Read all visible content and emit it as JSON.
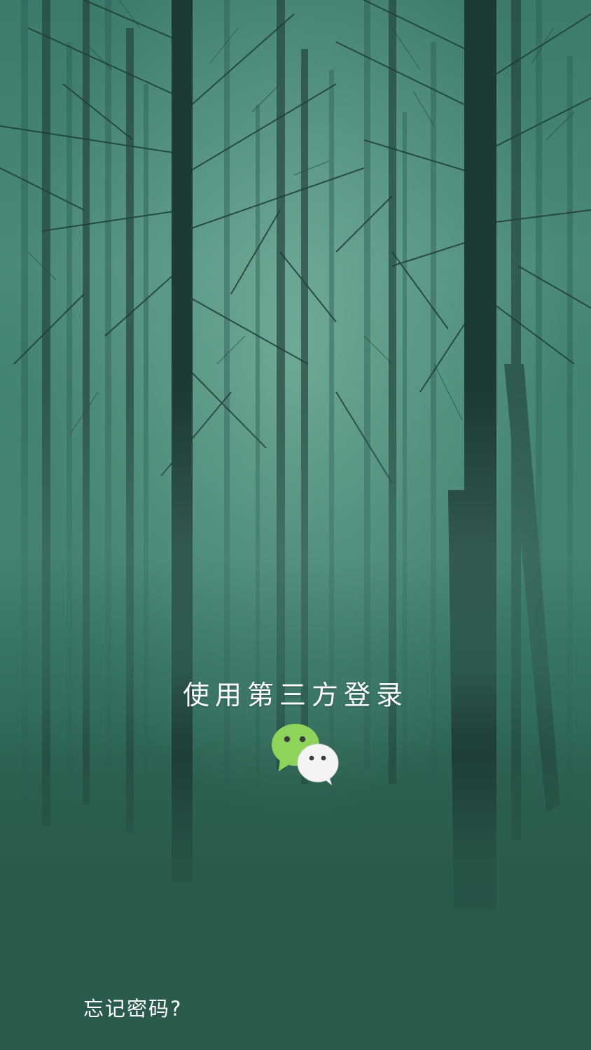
{
  "login": {
    "third_party_title": "使用第三方登录",
    "forgot_password": "忘记密码?"
  },
  "icons": {
    "wechat": "wechat-icon"
  },
  "colors": {
    "background_top": "#3c7a6c",
    "background_bottom": "#2a5b4c",
    "tree_trunk": "#1e3d38",
    "text": "#ffffff",
    "wechat_green": "#8ed35a",
    "wechat_white": "#ffffff"
  }
}
